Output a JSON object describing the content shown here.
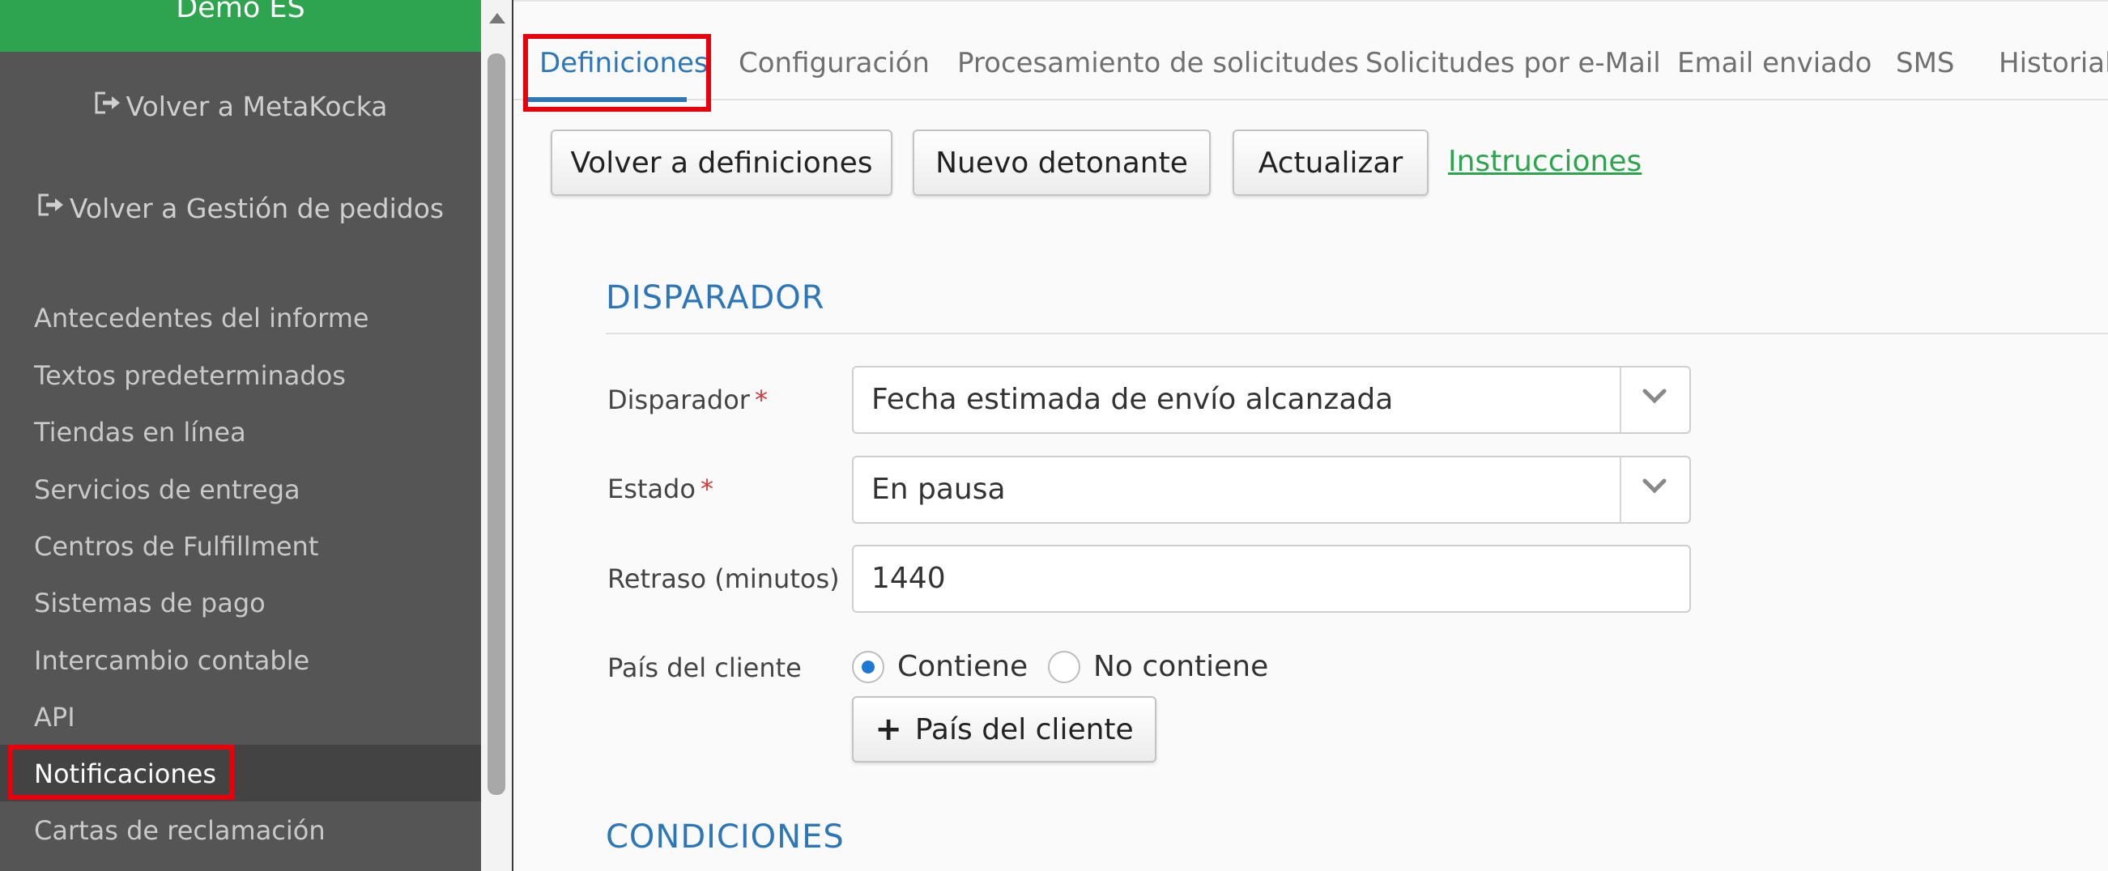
{
  "sidebar": {
    "brand": "Demo ES",
    "links": [
      {
        "label": "Volver a MetaKocka"
      },
      {
        "label": "Volver a Gestión de pedidos"
      }
    ],
    "items": [
      {
        "label": "Antecedentes del informe"
      },
      {
        "label": "Textos predeterminados"
      },
      {
        "label": "Tiendas en línea"
      },
      {
        "label": "Servicios de entrega"
      },
      {
        "label": "Centros de Fulfillment"
      },
      {
        "label": "Sistemas de pago"
      },
      {
        "label": "Intercambio contable"
      },
      {
        "label": "API"
      },
      {
        "label": "Notificaciones",
        "active": true
      },
      {
        "label": "Cartas de reclamación"
      }
    ]
  },
  "tabs": [
    {
      "label": "Definiciones",
      "active": true
    },
    {
      "label": "Configuración"
    },
    {
      "label": "Procesamiento de solicitudes"
    },
    {
      "label": "Solicitudes por e-Mail"
    },
    {
      "label": "Email enviado"
    },
    {
      "label": "SMS"
    },
    {
      "label": "Historial"
    }
  ],
  "toolbar": {
    "back_label": "Volver a definiciones",
    "new_trigger_label": "Nuevo detonante",
    "refresh_label": "Actualizar",
    "instructions_label": "Instrucciones"
  },
  "form": {
    "section_trigger": "DISPARADOR",
    "trigger_label": "Disparador",
    "trigger_value": "Fecha estimada de envío alcanzada",
    "state_label": "Estado",
    "state_value": "En pausa",
    "delay_label": "Retraso (minutos)",
    "delay_value": "1440",
    "country_label": "País del cliente",
    "radio_contains": "Contiene",
    "radio_not_contains": "No contiene",
    "radio_selected": "Contiene",
    "add_country_label": "País del cliente",
    "required_mark": "*",
    "section_conditions": "CONDICIONES"
  },
  "colors": {
    "brand_green": "#2ea44f",
    "sidebar_bg": "#555555",
    "accent_blue": "#2d77b8",
    "highlight_red": "#e8000b"
  }
}
